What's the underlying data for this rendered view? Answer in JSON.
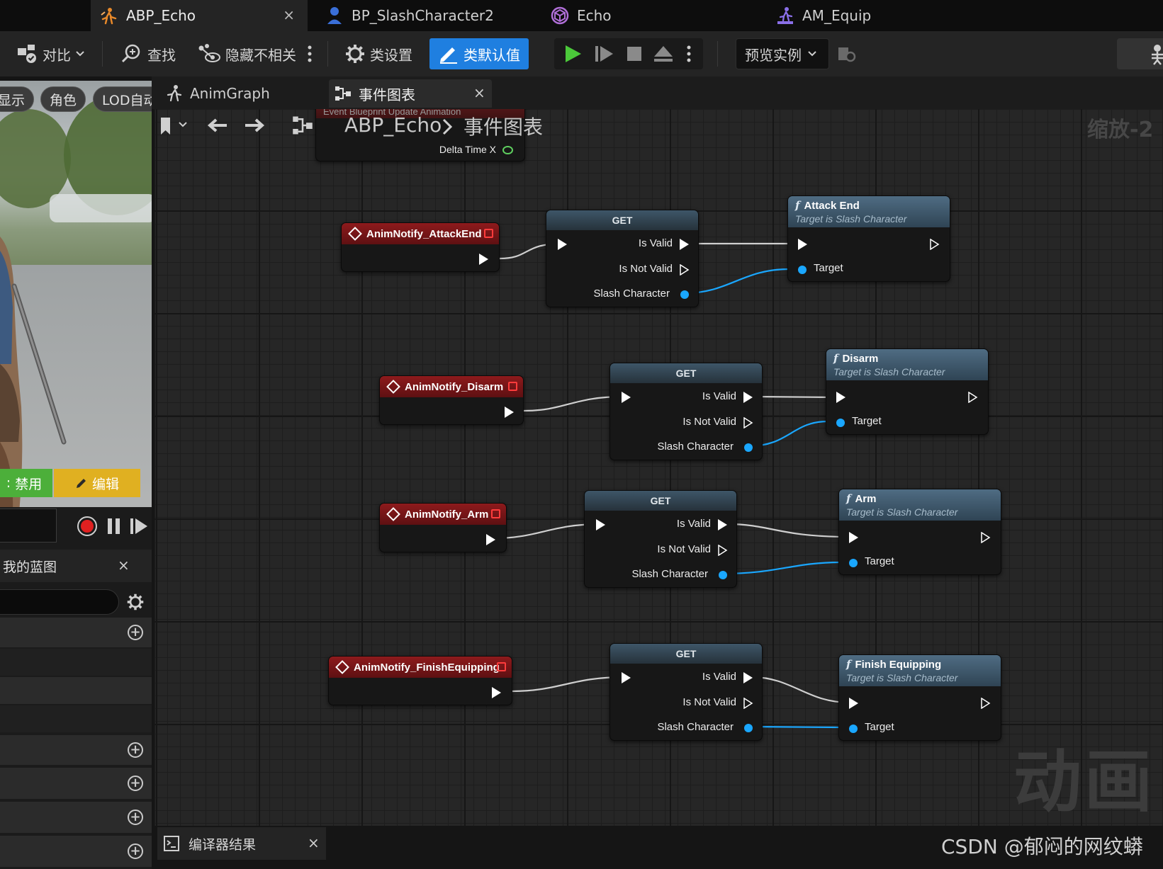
{
  "tabs": [
    {
      "label": "ABP_Echo",
      "close": "×"
    },
    {
      "label": "BP_SlashCharacter2"
    },
    {
      "label": "Echo"
    },
    {
      "label": "AM_Equip"
    }
  ],
  "toolbar": {
    "compare": "对比",
    "find": "查找",
    "hide_unrelated": "隐藏不相关",
    "class_settings": "类设置",
    "class_defaults": "类默认值",
    "preview_instance": "预览实例"
  },
  "viewport": {
    "pills": [
      "显示",
      "角色",
      "LOD自动"
    ],
    "disable": "禁用",
    "edit": "编辑"
  },
  "left_panel": {
    "my_blueprint": "我的蓝图",
    "close": "×"
  },
  "graph_tabs": {
    "anim_graph": "AnimGraph",
    "event_graph": "事件图表",
    "close": "×"
  },
  "breadcrumb": {
    "root": "ABP_Echo",
    "current": "事件图表",
    "zoom": "缩放-2"
  },
  "top_node": {
    "title": "Event Blueprint Update Animation",
    "pin": "Delta Time X"
  },
  "get_node": {
    "title": "GET",
    "is_valid": "Is Valid",
    "is_not_valid": "Is Not Valid",
    "object": "Slash Character"
  },
  "events": [
    {
      "name": "AnimNotify_AttackEnd"
    },
    {
      "name": "AnimNotify_Disarm"
    },
    {
      "name": "AnimNotify_Arm"
    },
    {
      "name": "AnimNotify_FinishEquipping"
    }
  ],
  "functions": [
    {
      "name": "Attack End",
      "target_note": "Target is Slash Character",
      "pin": "Target"
    },
    {
      "name": "Disarm",
      "target_note": "Target is Slash Character",
      "pin": "Target"
    },
    {
      "name": "Arm",
      "target_note": "Target is Slash Character",
      "pin": "Target"
    },
    {
      "name": "Finish Equipping",
      "target_note": "Target is Slash Character",
      "pin": "Target"
    }
  ],
  "watermark": "动画",
  "bottom": {
    "compiler_results": "编译器结果",
    "close": "×",
    "credit": "CSDN @郁闷的网纹蟒"
  },
  "colors": {
    "accent": "#1f7fe0",
    "event_header": "#8e1a1c",
    "function_header": "#4f6c83",
    "object_pin": "#1aa7ff",
    "disable_btn": "#4caf3a",
    "edit_btn": "#e0b021"
  }
}
